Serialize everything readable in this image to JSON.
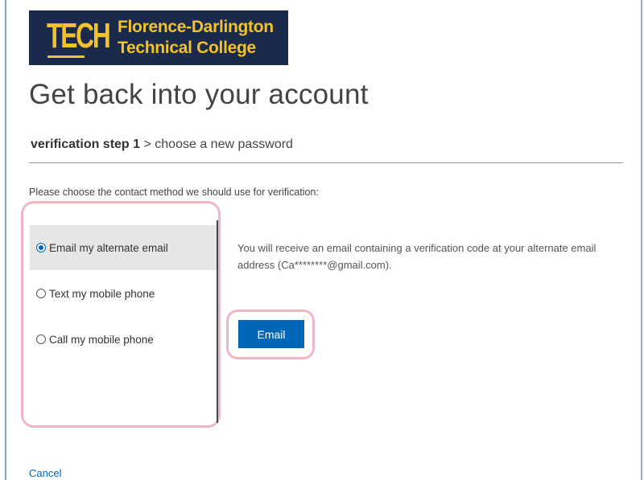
{
  "logo": {
    "mark": "TECH",
    "line1": "Florence-Darlington",
    "line2": "Technical College"
  },
  "page": {
    "title": "Get back into your account"
  },
  "breadcrumb": {
    "current": "verification step 1",
    "separator": " > ",
    "next": "choose a new password"
  },
  "verification": {
    "prompt": "Please choose the contact method we should use for verification:",
    "options": [
      {
        "label": "Email my alternate email",
        "selected": true
      },
      {
        "label": "Text my mobile phone",
        "selected": false
      },
      {
        "label": "Call my mobile phone",
        "selected": false
      }
    ],
    "info": "You will receive an email containing a verification code at your alternate email address (Ca********@gmail.com).",
    "button_label": "Email"
  },
  "footer": {
    "cancel_label": "Cancel"
  },
  "colors": {
    "accent": "#0067b8",
    "logo_background": "#1b2a4a",
    "logo_text": "#f2c22a",
    "highlight": "#efb7c3"
  }
}
